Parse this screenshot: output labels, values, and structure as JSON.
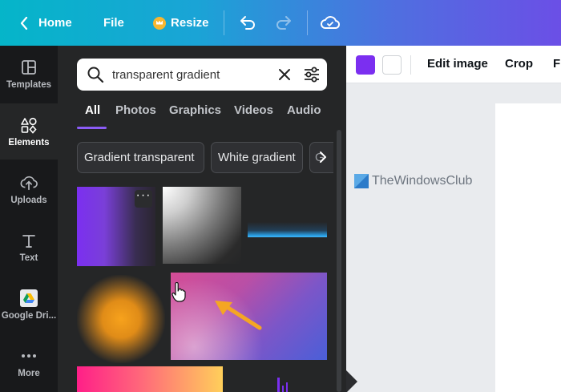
{
  "topbar": {
    "home": "Home",
    "file": "File",
    "resize": "Resize"
  },
  "rail": {
    "items": [
      {
        "label": "Templates",
        "icon": "templates-icon"
      },
      {
        "label": "Elements",
        "icon": "elements-icon"
      },
      {
        "label": "Uploads",
        "icon": "cloud-upload-icon"
      },
      {
        "label": "Text",
        "icon": "text-icon"
      },
      {
        "label": "Google Dri...",
        "icon": "google-drive-icon"
      },
      {
        "label": "More",
        "icon": "more-dots-icon"
      }
    ],
    "active": "Elements"
  },
  "search": {
    "value": "transparent gradient"
  },
  "tabs": [
    "All",
    "Photos",
    "Graphics",
    "Videos",
    "Audio"
  ],
  "active_tab": "All",
  "chips": [
    "Gradient transparent",
    "White gradient",
    "G"
  ],
  "editor": {
    "color_1": "#7b2ff0",
    "color_2": "#ffffff",
    "edit_image": "Edit image",
    "crop": "Crop",
    "flip_partial": "Fl"
  },
  "watermark": "TheWindowsClub",
  "colors": {
    "accent": "#8b5cf6",
    "arrow": "#f5a623",
    "topbar_start": "#05b5c9",
    "topbar_end": "#6b4fe6"
  }
}
